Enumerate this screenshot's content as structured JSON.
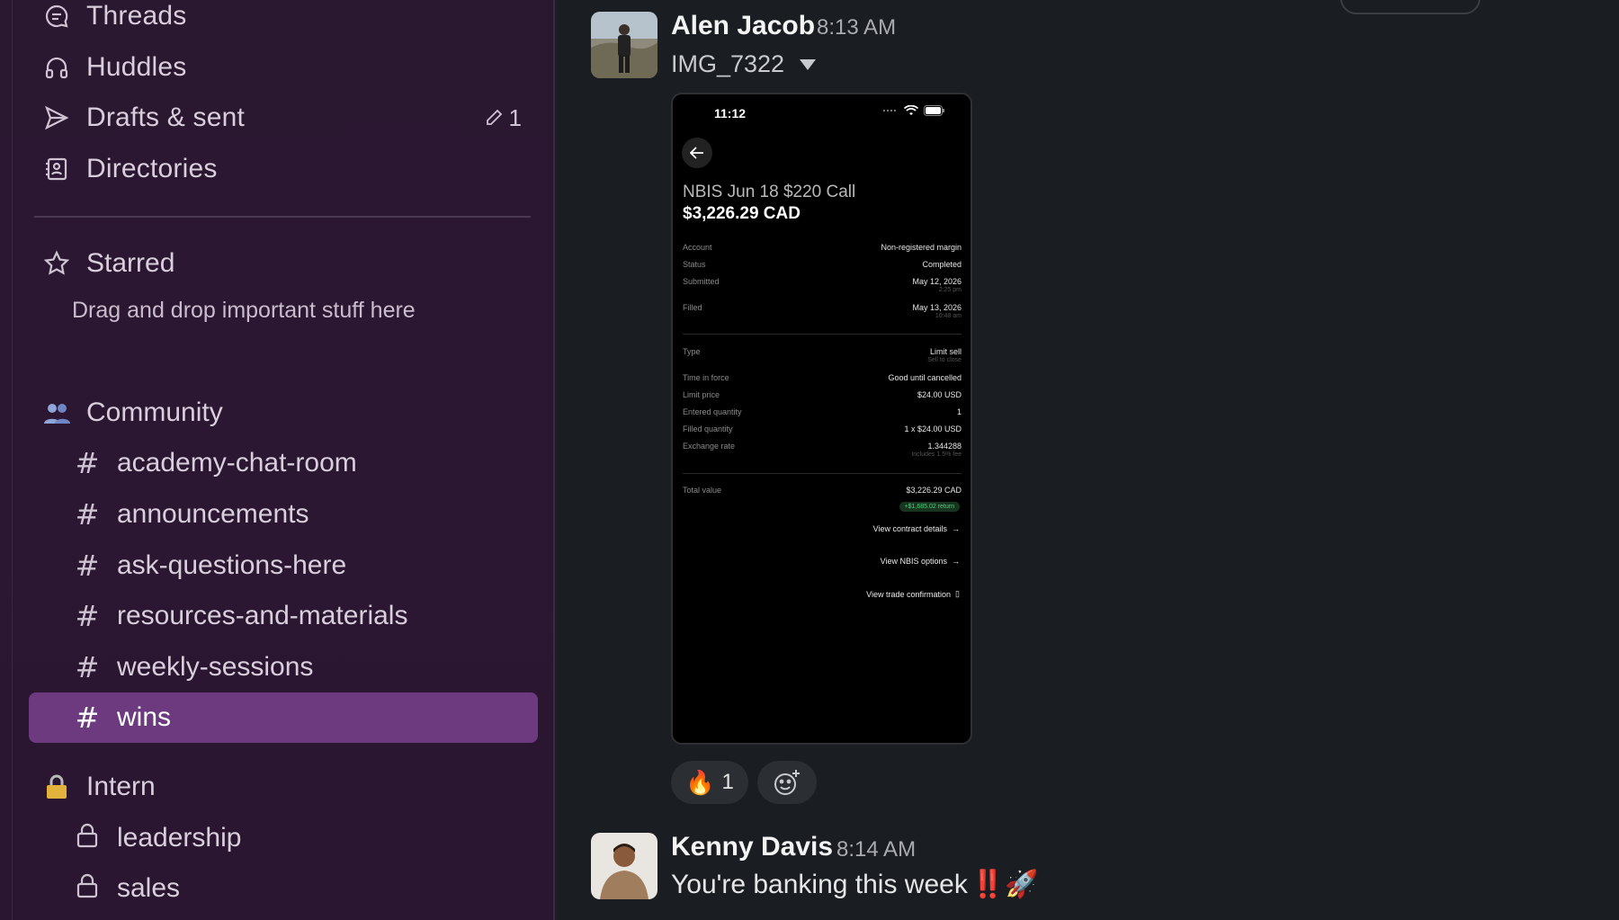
{
  "sidebar": {
    "nav": [
      {
        "label": "Threads",
        "icon": "threads-icon"
      },
      {
        "label": "Huddles",
        "icon": "headphones-icon"
      },
      {
        "label": "Drafts & sent",
        "icon": "send-icon",
        "badge": "1"
      },
      {
        "label": "Directories",
        "icon": "directory-icon"
      }
    ],
    "starred": {
      "label": "Starred",
      "hint": "Drag and drop important stuff here"
    },
    "community": {
      "label": "Community",
      "channels": [
        "academy-chat-room",
        "announcements",
        "ask-questions-here",
        "resources-and-materials",
        "weekly-sessions",
        "wins"
      ],
      "active": "wins"
    },
    "intern": {
      "label": "Intern",
      "channels": [
        "leadership",
        "sales"
      ]
    }
  },
  "messages": [
    {
      "author": "Alen Jacob",
      "time": "8:13 AM",
      "file_name": "IMG_7322",
      "reaction": {
        "emoji": "🔥",
        "count": "1"
      }
    },
    {
      "author": "Kenny Davis",
      "time": "8:14 AM",
      "text": "You're banking this week",
      "emojis": "‼️🚀"
    }
  ],
  "screenshot": {
    "status_time": "11:12",
    "title": "NBIS Jun 18 $220 Call",
    "amount": "$3,226.29 CAD",
    "rows": [
      {
        "k": "Account",
        "v": "Non-registered margin"
      },
      {
        "k": "Status",
        "v": "Completed"
      },
      {
        "k": "Submitted",
        "v": "May 12, 2026",
        "sub": "2:25 pm"
      },
      {
        "k": "Filled",
        "v": "May 13, 2026",
        "sub": "10:48 am"
      },
      {
        "k": "Type",
        "v": "Limit sell",
        "sub": "Sell to close"
      },
      {
        "k": "Time in force",
        "v": "Good until cancelled"
      },
      {
        "k": "Limit price",
        "v": "$24.00 USD"
      },
      {
        "k": "Entered quantity",
        "v": "1"
      },
      {
        "k": "Filled quantity",
        "v": "1 x $24.00 USD"
      },
      {
        "k": "Exchange rate",
        "v": "1.344288",
        "sub": "Includes 1.5% fee"
      },
      {
        "k": "Total value",
        "v": "$3,226.29 CAD"
      }
    ],
    "return_pill": "+$1,685.02 return",
    "links": [
      "View contract details",
      "View NBIS options",
      "View trade confirmation"
    ]
  },
  "colors": {
    "sidebar_bg": "#2a1730",
    "active_channel": "#6d3a80",
    "main_bg": "#1a1d21"
  }
}
